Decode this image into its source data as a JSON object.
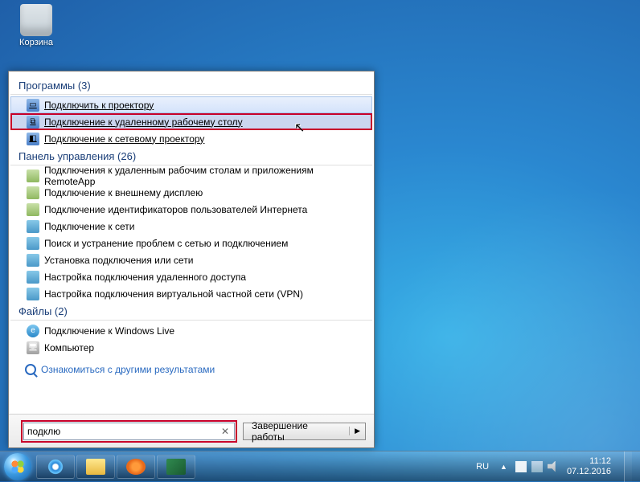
{
  "desktop": {
    "recycle_bin": "Корзина"
  },
  "start": {
    "sections": {
      "programs": {
        "header": "Программы (3)",
        "items": [
          {
            "label": "Подключить к проектору",
            "icon": "projector"
          },
          {
            "label": "Подключение к удаленному рабочему столу",
            "icon": "rdp",
            "highlight": true
          },
          {
            "label": "Подключение к сетевому проектору",
            "icon": "net-projector"
          }
        ]
      },
      "control_panel": {
        "header": "Панель управления (26)",
        "items": [
          {
            "label": "Подключения к удаленным рабочим столам и приложениям RemoteApp"
          },
          {
            "label": "Подключение к внешнему дисплею"
          },
          {
            "label": "Подключение идентификаторов пользователей Интернета"
          },
          {
            "label": "Подключение к сети"
          },
          {
            "label": "Поиск и устранение проблем с сетью и подключением"
          },
          {
            "label": "Установка подключения или сети"
          },
          {
            "label": "Настройка подключения удаленного доступа"
          },
          {
            "label": "Настройка подключения виртуальной частной сети (VPN)"
          }
        ]
      },
      "files": {
        "header": "Файлы (2)",
        "items": [
          {
            "label": "Подключение к Windows Live",
            "icon": "ie"
          },
          {
            "label": "Компьютер",
            "icon": "pc"
          }
        ]
      }
    },
    "see_more": "Ознакомиться с другими результатами",
    "search_value": "подклю",
    "shutdown": "Завершение работы"
  },
  "tray": {
    "lang": "RU",
    "time": "11:12",
    "date": "07.12.2016"
  }
}
